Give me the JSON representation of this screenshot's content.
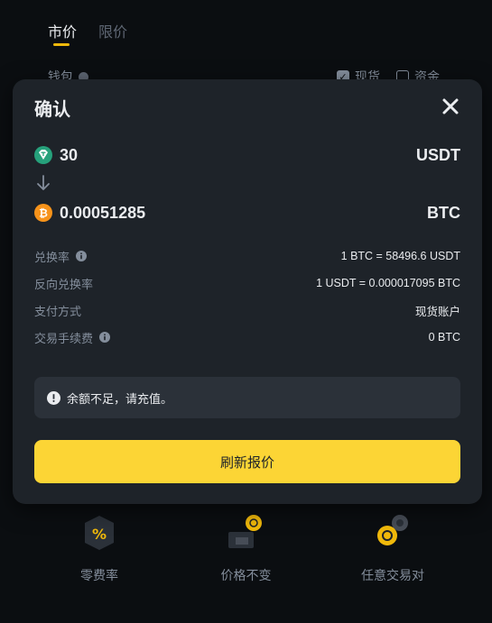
{
  "background": {
    "tabs": [
      {
        "label": "市价",
        "active": true
      },
      {
        "label": "限价",
        "active": false
      }
    ],
    "wallet_label": "钱包",
    "wallet_options": [
      {
        "label": "现货",
        "checked": true
      },
      {
        "label": "资金",
        "checked": false
      }
    ],
    "features": [
      {
        "label": "零费率",
        "icon": "percent-icon"
      },
      {
        "label": "价格不变",
        "icon": "price-lock-icon"
      },
      {
        "label": "任意交易对",
        "icon": "coin-pair-icon"
      }
    ]
  },
  "modal": {
    "title": "确认",
    "from": {
      "amount": "30",
      "unit": "USDT",
      "icon": "usdt-icon"
    },
    "to": {
      "amount": "0.00051285",
      "unit": "BTC",
      "icon": "btc-icon"
    },
    "details": [
      {
        "label": "兑换率",
        "value": "1 BTC = 58496.6 USDT",
        "info": true
      },
      {
        "label": "反向兑换率",
        "value": "1 USDT = 0.000017095 BTC",
        "info": false
      },
      {
        "label": "支付方式",
        "value": "现货账户",
        "info": false
      },
      {
        "label": "交易手续费",
        "value": "0 BTC",
        "info": true
      }
    ],
    "warning": "余额不足，请充值。",
    "button_label": "刷新报价"
  },
  "colors": {
    "page_bg": "#0b0e11",
    "modal_bg": "#1e2329",
    "accent": "#fcd535",
    "brand_yellow": "#f0b90b",
    "usdt_teal": "#26a17b",
    "btc_orange": "#f7931a"
  }
}
